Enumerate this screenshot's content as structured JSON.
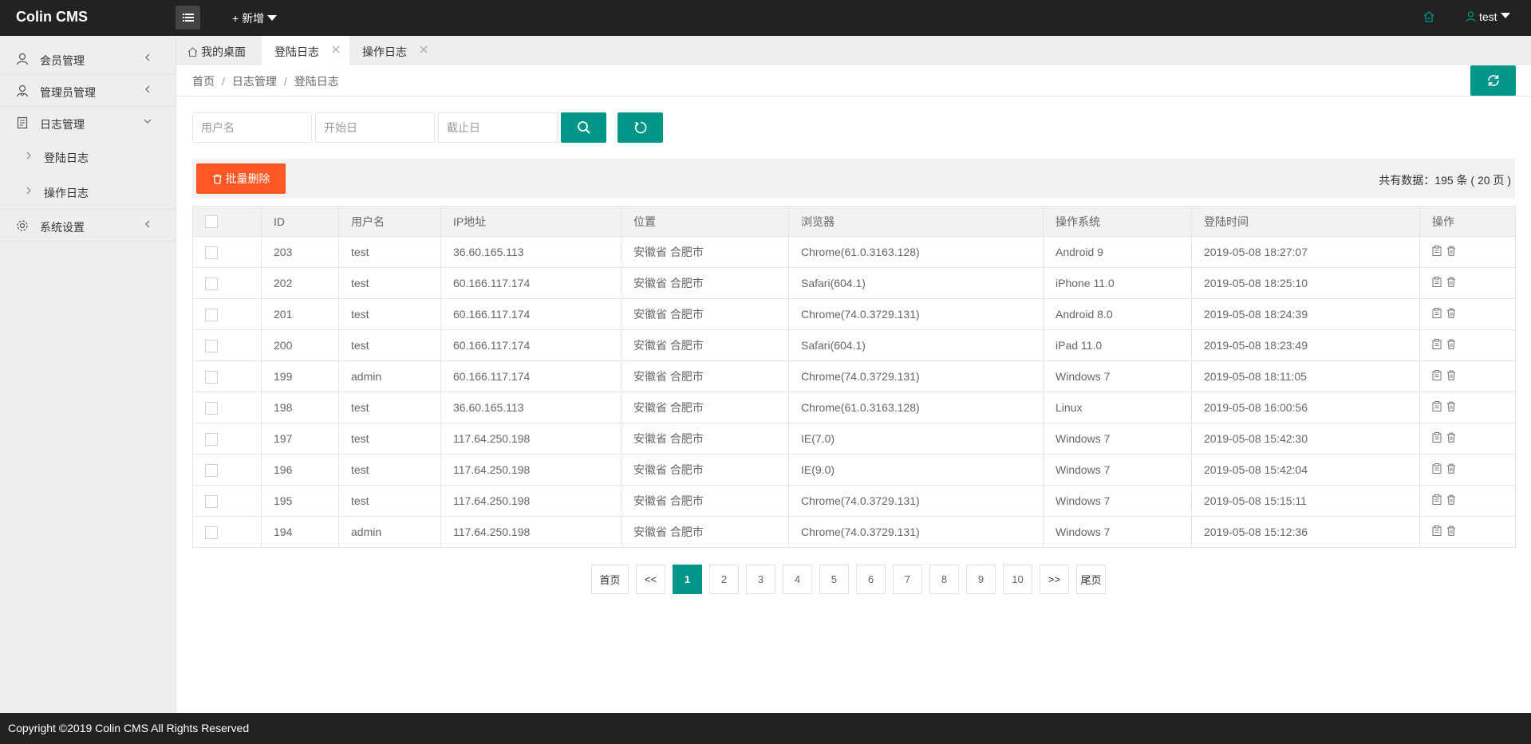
{
  "header": {
    "logo": "Colin CMS",
    "add_new": "+ 新增",
    "user": "test"
  },
  "sidebar": {
    "items": [
      {
        "label": "会员管理"
      },
      {
        "label": "管理员管理"
      },
      {
        "label": "日志管理"
      },
      {
        "label": "系统设置"
      }
    ],
    "sub_items": [
      {
        "label": "登陆日志"
      },
      {
        "label": "操作日志"
      }
    ]
  },
  "tabs": [
    {
      "label": "我的桌面"
    },
    {
      "label": "登陆日志"
    },
    {
      "label": "操作日志"
    }
  ],
  "breadcrumb": [
    "首页",
    "日志管理",
    "登陆日志"
  ],
  "search": {
    "username_placeholder": "用户名",
    "start_placeholder": "开始日",
    "end_placeholder": "截止日"
  },
  "toolbar": {
    "batch_delete": "批量删除",
    "total": "共有数据：195 条 ( 20 页 )"
  },
  "table": {
    "headers": [
      "ID",
      "用户名",
      "IP地址",
      "位置",
      "浏览器",
      "操作系统",
      "登陆时间",
      "操作"
    ],
    "rows": [
      [
        "203",
        "test",
        "36.60.165.113",
        "安徽省 合肥市",
        "Chrome(61.0.3163.128)",
        "Android 9",
        "2019-05-08 18:27:07"
      ],
      [
        "202",
        "test",
        "60.166.117.174",
        "安徽省 合肥市",
        "Safari(604.1)",
        "iPhone 11.0",
        "2019-05-08 18:25:10"
      ],
      [
        "201",
        "test",
        "60.166.117.174",
        "安徽省 合肥市",
        "Chrome(74.0.3729.131)",
        "Android 8.0",
        "2019-05-08 18:24:39"
      ],
      [
        "200",
        "test",
        "60.166.117.174",
        "安徽省 合肥市",
        "Safari(604.1)",
        "iPad 11.0",
        "2019-05-08 18:23:49"
      ],
      [
        "199",
        "admin",
        "60.166.117.174",
        "安徽省 合肥市",
        "Chrome(74.0.3729.131)",
        "Windows 7",
        "2019-05-08 18:11:05"
      ],
      [
        "198",
        "test",
        "36.60.165.113",
        "安徽省 合肥市",
        "Chrome(61.0.3163.128)",
        "Linux",
        "2019-05-08 16:00:56"
      ],
      [
        "197",
        "test",
        "117.64.250.198",
        "安徽省 合肥市",
        "IE(7.0)",
        "Windows 7",
        "2019-05-08 15:42:30"
      ],
      [
        "196",
        "test",
        "117.64.250.198",
        "安徽省 合肥市",
        "IE(9.0)",
        "Windows 7",
        "2019-05-08 15:42:04"
      ],
      [
        "195",
        "test",
        "117.64.250.198",
        "安徽省 合肥市",
        "Chrome(74.0.3729.131)",
        "Windows 7",
        "2019-05-08 15:15:11"
      ],
      [
        "194",
        "admin",
        "117.64.250.198",
        "安徽省 合肥市",
        "Chrome(74.0.3729.131)",
        "Windows 7",
        "2019-05-08 15:12:36"
      ]
    ]
  },
  "pagination": {
    "first": "首页",
    "prev": "<<",
    "pages": [
      "1",
      "2",
      "3",
      "4",
      "5",
      "6",
      "7",
      "8",
      "9",
      "10"
    ],
    "current": "1",
    "next": ">>",
    "last": "尾页"
  },
  "footer": "Copyright ©2019 Colin CMS All Rights Reserved",
  "colors": {
    "header_bg": "#222222",
    "primary": "#009688",
    "danger": "#ff5722",
    "sidebar_bg": "#eeeeee"
  },
  "icons": {
    "menu_toggle": "list-icon",
    "home": "home-icon",
    "user": "user-icon",
    "refresh": "refresh-icon",
    "search": "search-icon",
    "reset": "reset-icon",
    "trash": "trash-icon",
    "edit": "edit-icon"
  }
}
